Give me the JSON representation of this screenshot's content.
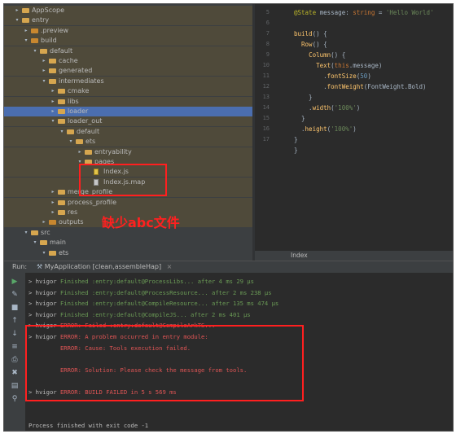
{
  "tree": {
    "items": [
      {
        "label": "AppScope",
        "arrow": "▸",
        "icon": "folder"
      },
      {
        "label": "entry",
        "arrow": "▾",
        "icon": "folder"
      },
      {
        "label": ".preview",
        "arrow": "▸",
        "icon": "folder-orange"
      },
      {
        "label": "build",
        "arrow": "▾",
        "icon": "folder-orange"
      },
      {
        "label": "default",
        "arrow": "▾",
        "icon": "folder"
      },
      {
        "label": "cache",
        "arrow": "▸",
        "icon": "folder"
      },
      {
        "label": "generated",
        "arrow": "▸",
        "icon": "folder"
      },
      {
        "label": "intermediates",
        "arrow": "▾",
        "icon": "folder"
      },
      {
        "label": "cmake",
        "arrow": "▸",
        "icon": "folder"
      },
      {
        "label": "libs",
        "arrow": "▸",
        "icon": "folder"
      },
      {
        "label": "loader",
        "arrow": "▸",
        "icon": "folder"
      },
      {
        "label": "loader_out",
        "arrow": "▾",
        "icon": "folder"
      },
      {
        "label": "default",
        "arrow": "▾",
        "icon": "folder"
      },
      {
        "label": "ets",
        "arrow": "▾",
        "icon": "folder"
      },
      {
        "label": "entryability",
        "arrow": "▸",
        "icon": "folder"
      },
      {
        "label": "pages",
        "arrow": "▾",
        "icon": "folder"
      },
      {
        "label": "Index.js",
        "arrow": "",
        "icon": "file-js"
      },
      {
        "label": "Index.js.map",
        "arrow": "",
        "icon": "file"
      },
      {
        "label": "merge_profile",
        "arrow": "▸",
        "icon": "folder"
      },
      {
        "label": "process_profile",
        "arrow": "▸",
        "icon": "folder"
      },
      {
        "label": "res",
        "arrow": "▸",
        "icon": "folder"
      },
      {
        "label": "outputs",
        "arrow": "▸",
        "icon": "folder-orange"
      },
      {
        "label": "src",
        "arrow": "▾",
        "icon": "folder"
      },
      {
        "label": "main",
        "arrow": "▾",
        "icon": "folder"
      },
      {
        "label": "ets",
        "arrow": "▾",
        "icon": "folder"
      }
    ]
  },
  "editor": {
    "line_numbers": [
      "5",
      "6",
      "7",
      "8",
      "9",
      "10",
      "11",
      "12",
      "13",
      "14",
      "15",
      "16",
      "17"
    ],
    "lines": [
      "@State message: string = 'Hello World'",
      "",
      "build() {",
      "  Row() {",
      "    Column() {",
      "      Text(this.message)",
      "        .fontSize(50)",
      "        .fontWeight(FontWeight.Bold)",
      "    }",
      "    .width('100%')",
      "  }",
      "  .height('100%')",
      "}",
      "}"
    ],
    "tab_label": "Index"
  },
  "run": {
    "label": "Run:",
    "tab": "MyApplication [clean,assembleHap]",
    "close": "×"
  },
  "console": {
    "lines": [
      {
        "prefix": "> hvigor ",
        "text": "Finished :entry:default@ProcessLibs... after 4 ms 29 µs",
        "color": "green"
      },
      {
        "prefix": "> hvigor ",
        "text": "Finished :entry:default@ProcessResource... after 2 ms 238 µs",
        "color": "green"
      },
      {
        "prefix": "> hvigor ",
        "text": "Finished :entry:default@CompileResource... after 135 ms 474 µs",
        "color": "green"
      },
      {
        "prefix": "> hvigor ",
        "text": "Finished :entry:default@CompileJS... after 2 ms 401 µs",
        "color": "green"
      },
      {
        "prefix": "> hvigor ",
        "text": "ERROR: Failed :entry:default@CompileArkTS...",
        "color": "red"
      },
      {
        "prefix": "> hvigor ",
        "text": "ERROR: A problem occurred in entry module:",
        "color": "red"
      },
      {
        "prefix": "         ",
        "text": "ERROR: Cause: Tools execution failed.",
        "color": "red"
      },
      {
        "prefix": "",
        "text": "",
        "color": "red"
      },
      {
        "prefix": "         ",
        "text": "ERROR: Solution: Please check the message from tools.",
        "color": "red"
      },
      {
        "prefix": "",
        "text": "",
        "color": "red"
      },
      {
        "prefix": "> hvigor ",
        "text": "ERROR: BUILD FAILED in 5 s 569 ms",
        "color": "red"
      },
      {
        "prefix": "",
        "text": "",
        "color": "plain"
      },
      {
        "prefix": "",
        "text": "",
        "color": "plain"
      },
      {
        "prefix": "Process finished with exit code -1",
        "text": "",
        "color": "plain"
      }
    ]
  },
  "annotation": {
    "text": "缺少abc文件",
    "color": "#ff2020"
  },
  "toolbar": {
    "icons": [
      "run-icon",
      "wrench-icon",
      "stop-icon",
      "up-icon",
      "down-icon",
      "soft-wrap-icon",
      "print-icon",
      "delete-icon",
      "layout-icon",
      "pin-icon"
    ]
  }
}
